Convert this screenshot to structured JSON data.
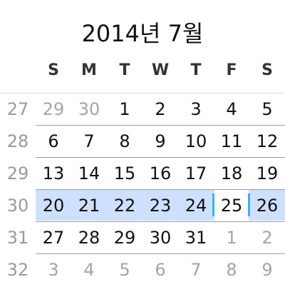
{
  "header": {
    "month_title": "2014년 7월"
  },
  "weekdays": [
    "S",
    "M",
    "T",
    "W",
    "T",
    "F",
    "S"
  ],
  "weeks": [
    {
      "number": "27",
      "days": [
        "29",
        "30",
        "1",
        "2",
        "3",
        "4",
        "5"
      ],
      "other_month": [
        true,
        true,
        false,
        false,
        false,
        false,
        false
      ]
    },
    {
      "number": "28",
      "days": [
        "6",
        "7",
        "8",
        "9",
        "10",
        "11",
        "12"
      ],
      "other_month": [
        false,
        false,
        false,
        false,
        false,
        false,
        false
      ]
    },
    {
      "number": "29",
      "days": [
        "13",
        "14",
        "15",
        "16",
        "17",
        "18",
        "19"
      ],
      "other_month": [
        false,
        false,
        false,
        false,
        false,
        false,
        false
      ]
    },
    {
      "number": "30",
      "days": [
        "20",
        "21",
        "22",
        "23",
        "24",
        "25",
        "26"
      ],
      "other_month": [
        false,
        false,
        false,
        false,
        false,
        false,
        false
      ]
    },
    {
      "number": "31",
      "days": [
        "27",
        "28",
        "29",
        "30",
        "31",
        "1",
        "2"
      ],
      "other_month": [
        false,
        false,
        false,
        false,
        false,
        true,
        true
      ]
    },
    {
      "number": "32",
      "days": [
        "3",
        "4",
        "5",
        "6",
        "7",
        "8",
        "9"
      ],
      "other_month": [
        true,
        true,
        true,
        true,
        true,
        true,
        true
      ]
    }
  ],
  "colors": {
    "selected_week_bg": "#cfe0ff",
    "today_marker": "#33b5e5",
    "other_month_text": "#a5a5a5",
    "week_number_text": "#9a9a9a"
  }
}
